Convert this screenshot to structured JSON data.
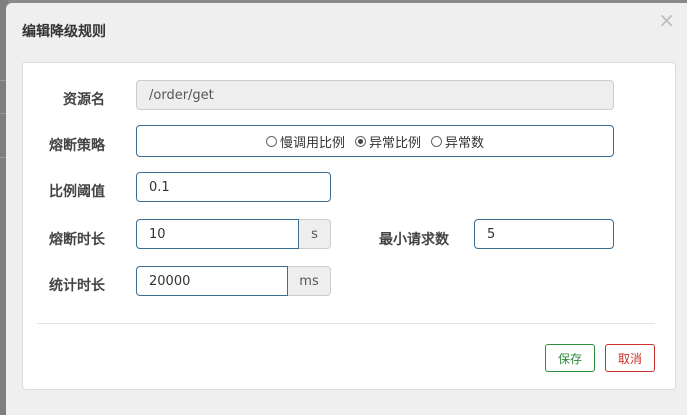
{
  "dialog": {
    "title": "编辑降级规则",
    "close_glyph": "×"
  },
  "form": {
    "resource": {
      "label": "资源名",
      "value": "/order/get"
    },
    "strategy": {
      "label": "熔断策略",
      "options": [
        "慢调用比例",
        "异常比例",
        "异常数"
      ],
      "selected": "异常比例"
    },
    "ratio_threshold": {
      "label": "比例阈值",
      "value": "0.1"
    },
    "break_duration": {
      "label": "熔断时长",
      "value": "10",
      "unit": "s"
    },
    "min_requests": {
      "label": "最小请求数",
      "value": "5"
    },
    "stat_duration": {
      "label": "统计时长",
      "value": "20000",
      "unit": "ms"
    }
  },
  "footer": {
    "save_label": "保存",
    "cancel_label": "取消"
  },
  "colors": {
    "input_border": "#3c6e91",
    "save": "#2e8b3a",
    "cancel": "#c9302c"
  }
}
